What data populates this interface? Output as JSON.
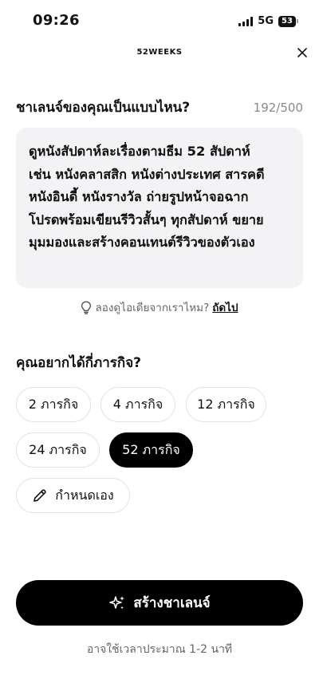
{
  "status_bar": {
    "time": "09:26",
    "network": "5G",
    "battery": "53"
  },
  "header": {
    "title": "52WEEKS"
  },
  "question": {
    "title": "ชาเลนจ์ของคุณเป็นแบบไหน?",
    "counter": "192/500"
  },
  "description": {
    "lines": [
      "ดูหนังสัปดาห์ละเรื่องตามธีม 52 สัปดาห์",
      "เช่น หนังคลาสสิก หนังต่างประเทศ สารคดี",
      "หนังอินดี้ หนังรางวัล ถ่ายรูปหน้าจอฉาก",
      "โปรดพร้อมเขียนรีวิวสั้นๆ ทุกสัปดาห์ ขยาย",
      "มุมมองและสร้างคอนเทนต์รีวิวของตัวเอง"
    ]
  },
  "hint": {
    "text": "ลองดูไอเดียจากเราไหม?",
    "link": "ถัดไป"
  },
  "missions": {
    "title": "คุณอยากได้กี่ภารกิจ?",
    "options": [
      "2 ภารกิจ",
      "4 ภารกิจ",
      "12 ภารกิจ",
      "24 ภารกิจ",
      "52 ภารกิจ"
    ],
    "selected": "52 ภารกิจ",
    "custom_label": "กำหนดเอง"
  },
  "create_button": {
    "label": "สร้างชาเลนจ์"
  },
  "footnote": "อาจใช้เวลาประมาณ 1-2 นาที",
  "icons": {
    "close": "close-icon",
    "hint": "lightbulb-icon",
    "custom": "pencil-icon",
    "create": "sparkles-icon"
  },
  "colors": {
    "primary": "#000000",
    "field_bg": "#f3f3f5",
    "muted": "#8a8a8a"
  }
}
